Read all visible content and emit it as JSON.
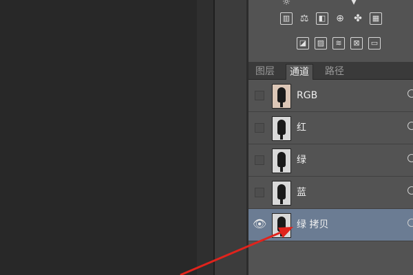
{
  "adjustments": {
    "row0": [
      "sun-icon",
      "rect-icon",
      "triangle-down-icon"
    ],
    "row1": [
      "levels-icon",
      "balance-icon",
      "black-white-icon",
      "photo-filter-icon",
      "channel-mixer-icon",
      "color-lookup-icon"
    ],
    "row2": [
      "invert-icon",
      "posterize-icon",
      "threshold-icon",
      "gradient-map-icon",
      "selective-color-icon"
    ]
  },
  "tabs": [
    {
      "label": "图层",
      "active": false
    },
    {
      "label": "通道",
      "active": true
    },
    {
      "label": "路径",
      "active": false
    }
  ],
  "channels": [
    {
      "name": "RGB",
      "visible": false,
      "selected": false
    },
    {
      "name": "红",
      "visible": false,
      "selected": false
    },
    {
      "name": "绿",
      "visible": false,
      "selected": false
    },
    {
      "name": "蓝",
      "visible": false,
      "selected": false
    },
    {
      "name": "绿 拷贝",
      "visible": true,
      "selected": true
    }
  ],
  "annotation": {
    "arrow_color": "#e0231c"
  },
  "colors": {
    "selected_row": "#6b7c93",
    "panel": "#535353",
    "canvas": "#282828"
  }
}
